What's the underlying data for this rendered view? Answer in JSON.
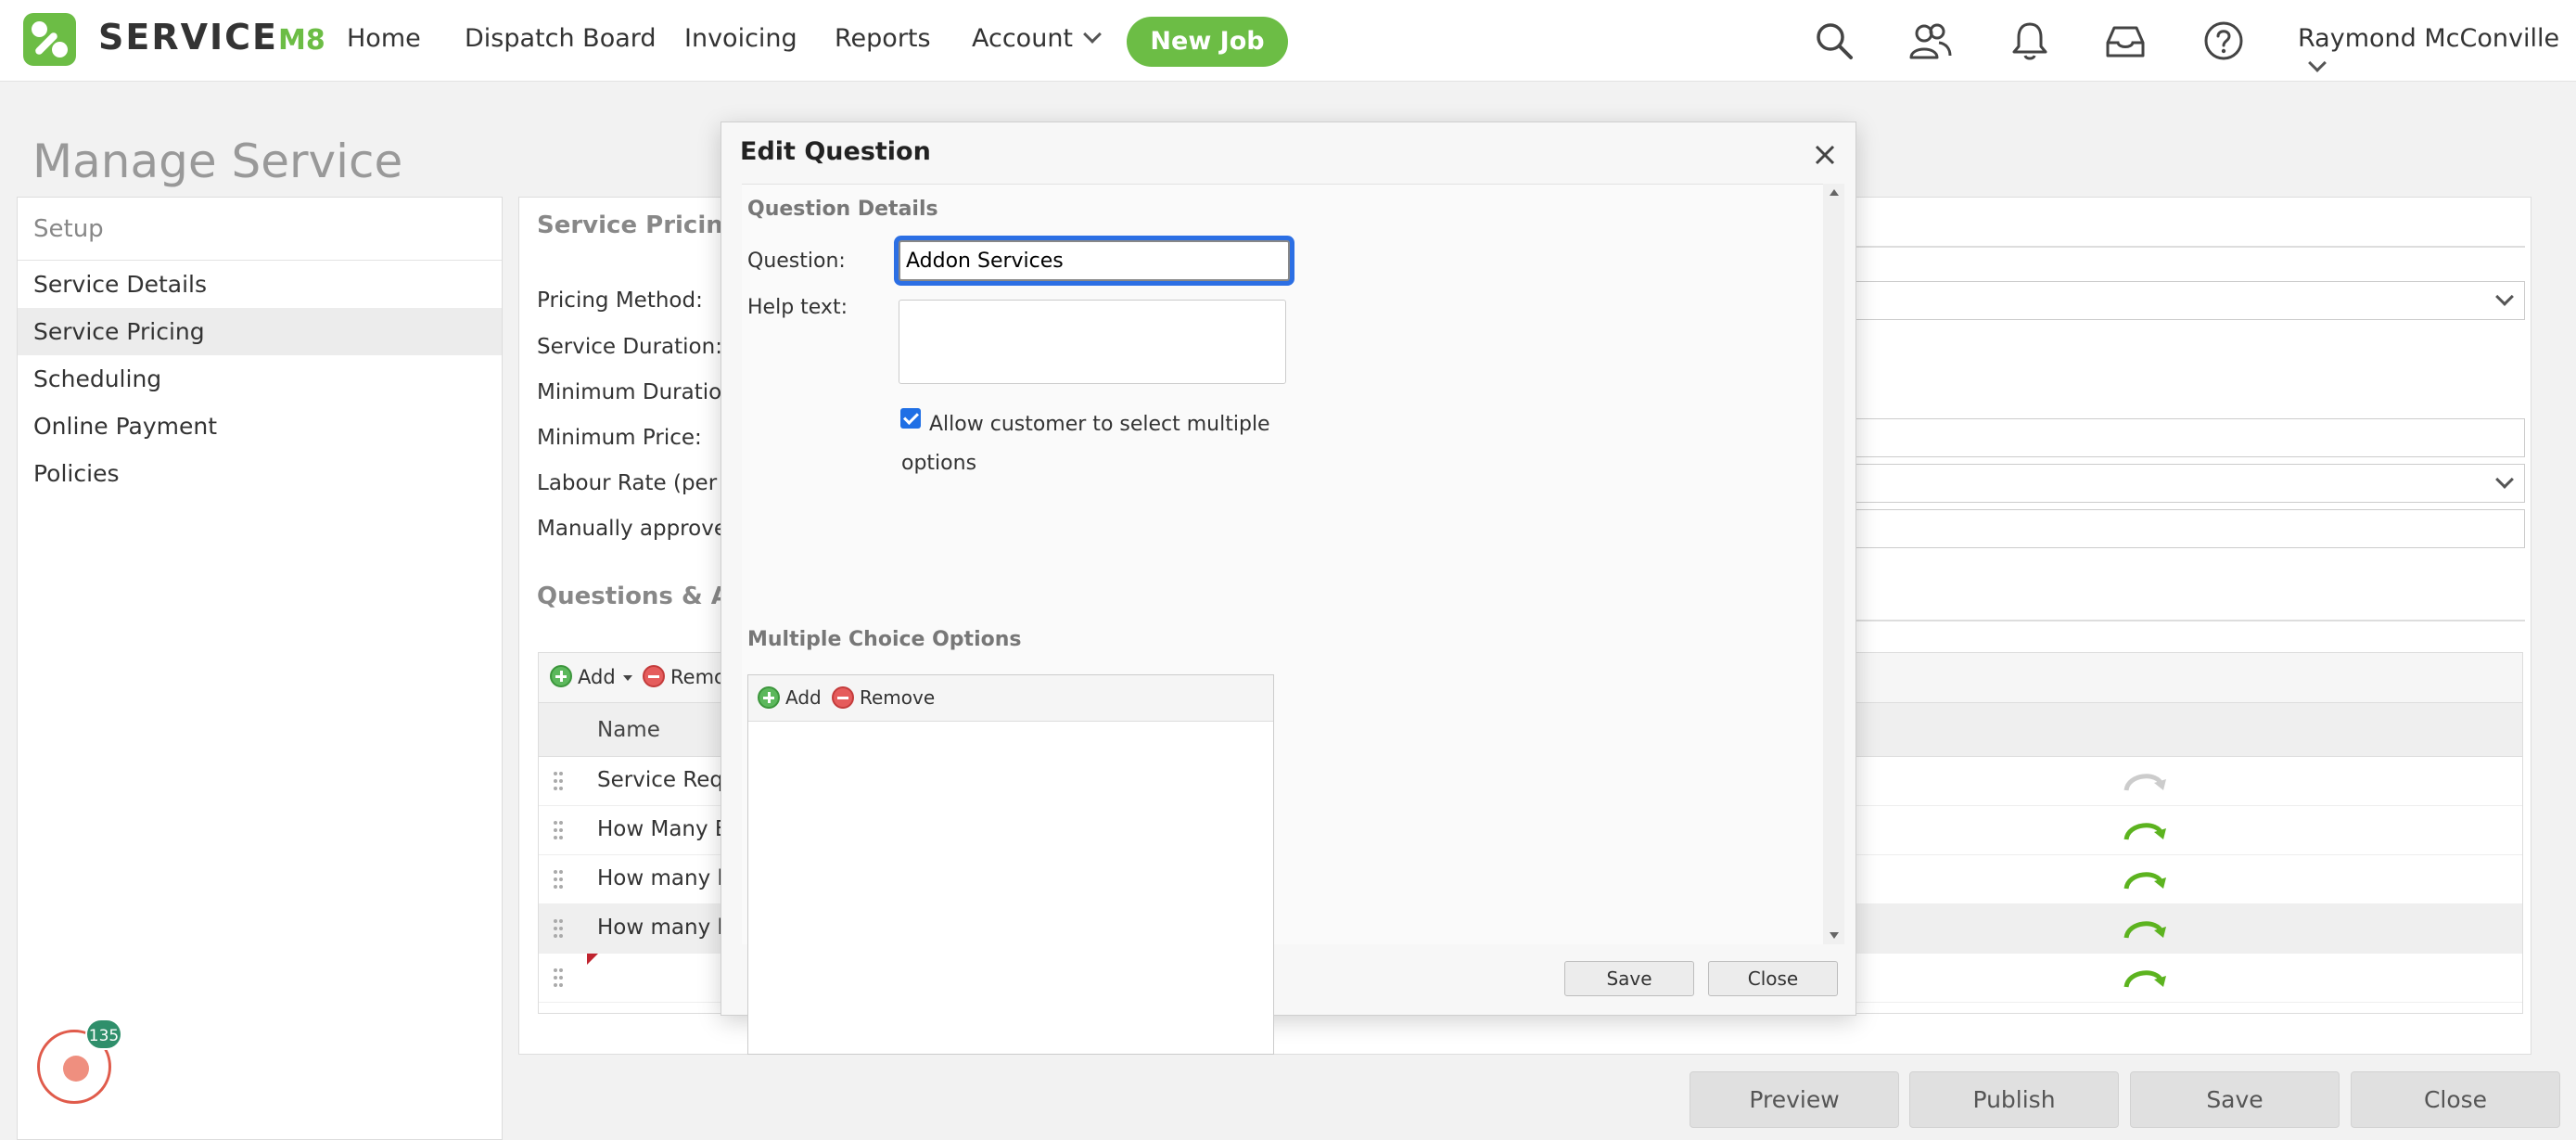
{
  "app": {
    "brand_text": "SERVICE",
    "brand_suffix": "M8"
  },
  "nav": {
    "items": [
      "Home",
      "Dispatch Board",
      "Invoicing",
      "Reports",
      "Account"
    ],
    "new_job": "New Job",
    "user_name": "Raymond McConville",
    "icons": [
      "search-icon",
      "people-icon",
      "bell-icon",
      "inbox-icon",
      "help-icon"
    ]
  },
  "page": {
    "title": "Manage Service"
  },
  "sidebar": {
    "header": "Setup",
    "items": [
      "Service Details",
      "Service Pricing",
      "Scheduling",
      "Online Payment",
      "Policies"
    ],
    "active_index": 1
  },
  "pricing": {
    "section_title": "Service Pricing",
    "labels": [
      "Pricing Method:",
      "Service Duration:",
      "Minimum Duration:",
      "Minimum Price:",
      "Labour Rate (per hou",
      "Manually approve jo"
    ]
  },
  "questions": {
    "section_title": "Questions & Actio",
    "toolbar": {
      "add": "Add",
      "remove": "Remo"
    },
    "column_name": "Name",
    "rows": [
      "Service Requi",
      "How Many Be",
      "How many be",
      "How many be",
      ""
    ],
    "selected_row": 3
  },
  "bottom_buttons": {
    "preview": "Preview",
    "publish": "Publish",
    "save": "Save",
    "close": "Close"
  },
  "recorder": {
    "badge": "135"
  },
  "modal": {
    "title": "Edit Question",
    "section_details": "Question Details",
    "question_label": "Question:",
    "question_value": "Addon Services",
    "help_label": "Help text:",
    "allow_multiple_label": "Allow customer to select multiple options",
    "allow_multiple_checked": true,
    "section_options": "Multiple Choice Options",
    "options_add": "Add",
    "options_remove": "Remove",
    "save": "Save",
    "close": "Close"
  },
  "colors": {
    "brand_green": "#6cbd45",
    "focus_blue": "#2c6fe4",
    "badge_green": "#2f8f6b",
    "record_red": "#e05b4b"
  }
}
